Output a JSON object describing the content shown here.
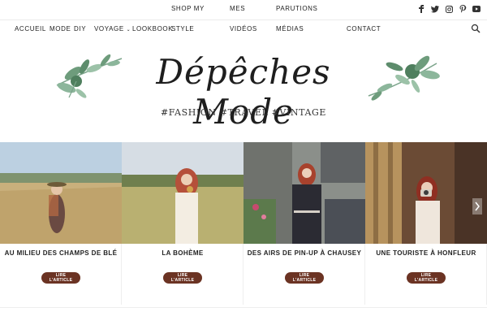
{
  "nav": {
    "top_row": [
      "SHOP MY",
      "MES",
      "PARUTIONS"
    ],
    "bottom_row": [
      "ACCUEIL",
      "MODE",
      "DIY",
      "VOYAGE",
      "LOOKBOOK",
      "STYLE",
      "VIDÉOS",
      "MÉDIAS",
      "CONTACT"
    ]
  },
  "social": {
    "icons": [
      "facebook-icon",
      "twitter-icon",
      "instagram-icon",
      "pinterest-icon",
      "youtube-icon"
    ]
  },
  "logo": {
    "text": "Dépêches Mode",
    "tagline": "#FASHION #TRAVEL #VINTAGE"
  },
  "cards": [
    {
      "title": "AU MILIEU DES CHAMPS DE BLÉ",
      "button": "LIRE\nL'ARTICLE"
    },
    {
      "title": "LA BOHÈME",
      "button": "LIRE\nL'ARTICLE"
    },
    {
      "title": "DES AIRS DE PIN-UP À CHAUSEY",
      "button": "LIRE\nL'ARTICLE"
    },
    {
      "title": "UNE TOURISTE À HONFLEUR",
      "button": "LIRE\nL'ARTICLE"
    }
  ],
  "colors": {
    "button": "#6b3323",
    "leaf": "#6e9c7c"
  }
}
